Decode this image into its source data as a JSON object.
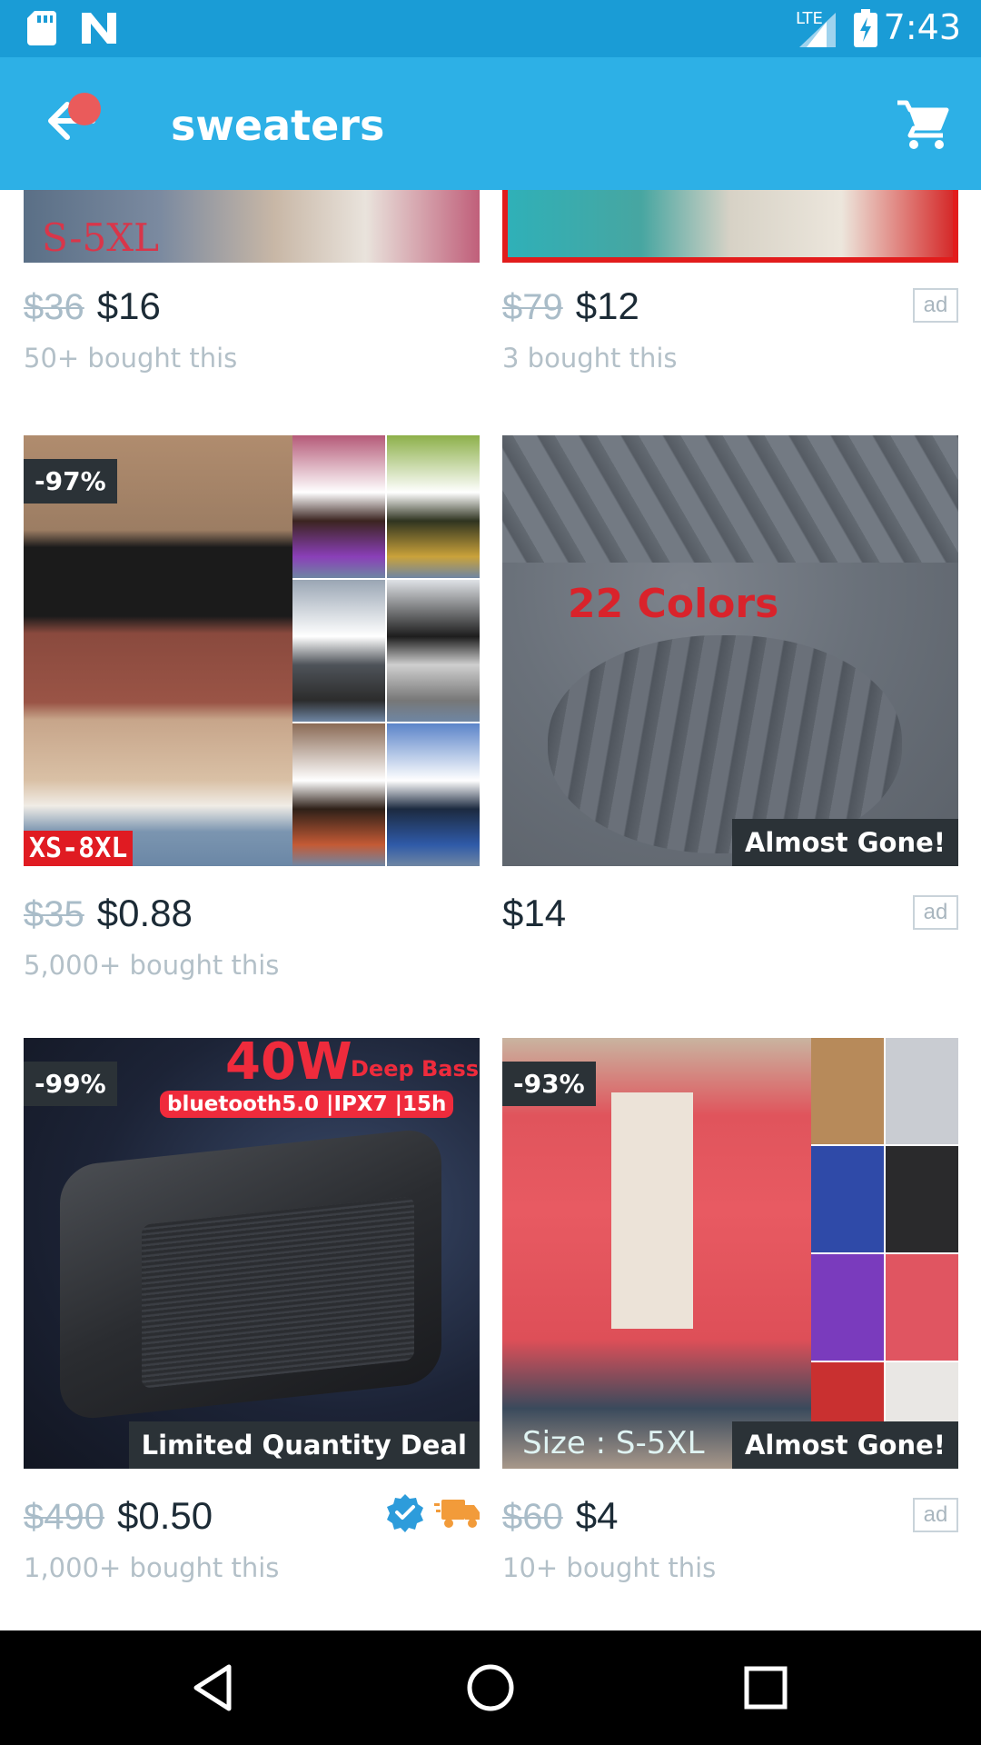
{
  "status_bar": {
    "time": "7:43",
    "network": "LTE",
    "icons": [
      "sd-card-icon",
      "n-app-icon",
      "signal-icon",
      "battery-charging-icon"
    ]
  },
  "app_bar": {
    "title": "sweaters",
    "back_icon": "back-arrow-icon",
    "cart_icon": "cart-icon"
  },
  "products": [
    {
      "old_price": "$36",
      "price": "$16",
      "bought": "50+ bought this",
      "image_text": "S-5XL"
    },
    {
      "old_price": "$79",
      "price": "$12",
      "bought": "3 bought this",
      "ad": "ad"
    },
    {
      "discount": "-97%",
      "old_price": "$35",
      "price": "$0.88",
      "bought": "5,000+ bought this",
      "image_text": "XS-8XL"
    },
    {
      "price": "$14",
      "ad": "ad",
      "banner": "Almost Gone!",
      "image_text": "22 Colors"
    },
    {
      "discount": "-99%",
      "old_price": "$490",
      "price": "$0.50",
      "bought": "1,000+ bought this",
      "banner": "Limited Quantity Deal",
      "image_text_1": "40W",
      "image_text_2": "Deep Bass",
      "image_text_3": "bluetooth5.0 |IPX7 |15h",
      "badges": [
        "verified-check-icon",
        "fast-shipping-truck-icon"
      ]
    },
    {
      "discount": "-93%",
      "old_price": "$60",
      "price": "$4",
      "bought": "10+ bought this",
      "ad": "ad",
      "banner": "Almost Gone!",
      "image_text": "Size : S-5XL"
    }
  ],
  "colors": {
    "status_bar": "#1a9cd6",
    "app_bar": "#2db0e6",
    "notification_dot": "#ea5b5b",
    "banner_bg": "#2b3237",
    "old_price": "#a9bcc8",
    "price": "#1c2b36"
  },
  "nav_bar": {
    "icons": [
      "nav-back-icon",
      "nav-home-icon",
      "nav-recents-icon"
    ]
  }
}
